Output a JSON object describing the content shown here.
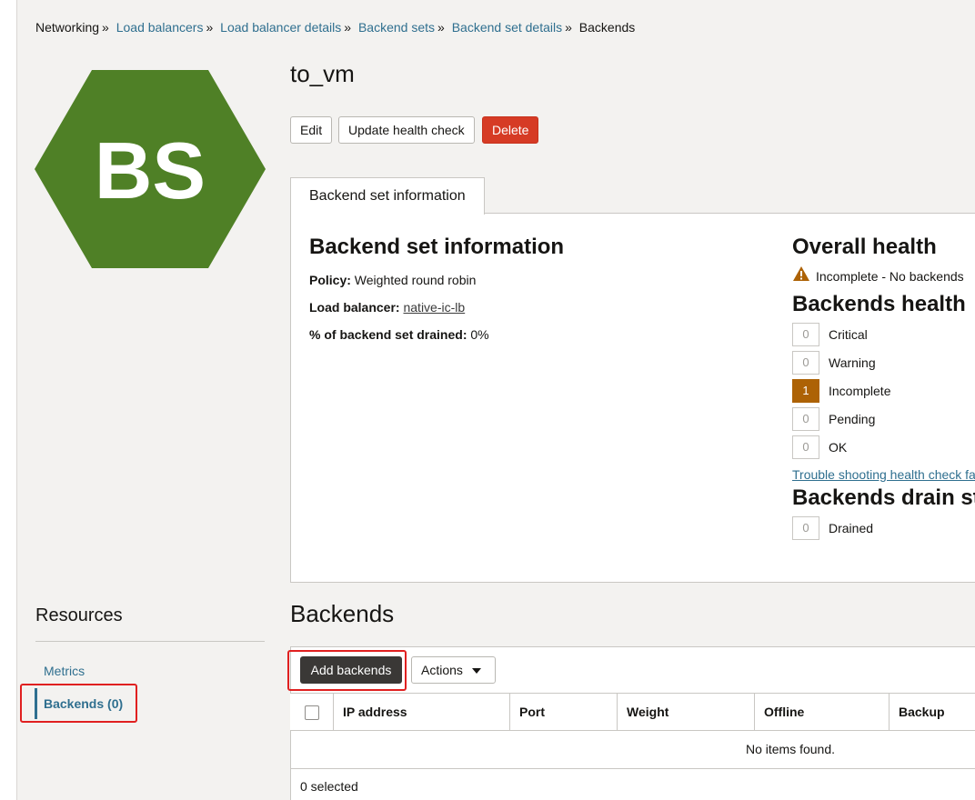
{
  "breadcrumb": {
    "root": "Networking",
    "links": [
      "Load balancers",
      "Load balancer details",
      "Backend sets",
      "Backend set details"
    ],
    "current": "Backends",
    "separator": "»"
  },
  "logo": {
    "text": "BS",
    "color": "#4f8026"
  },
  "page": {
    "title": "to_vm"
  },
  "toolbar": {
    "edit": "Edit",
    "update_health": "Update health check",
    "delete": "Delete"
  },
  "tab": {
    "label": "Backend set information"
  },
  "info": {
    "heading": "Backend set information",
    "policy_label": "Policy:",
    "policy_value": "Weighted round robin",
    "lb_label": "Load balancer:",
    "lb_value": "native-ic-lb",
    "drained_label": "% of backend set drained:",
    "drained_value": "0%"
  },
  "health": {
    "overall_heading": "Overall health",
    "overall_status": "Incomplete - No backends",
    "backends_heading": "Backends health",
    "rows": [
      {
        "count": "0",
        "label": "Critical"
      },
      {
        "count": "0",
        "label": "Warning"
      },
      {
        "count": "1",
        "label": "Incomplete"
      },
      {
        "count": "0",
        "label": "Pending"
      },
      {
        "count": "0",
        "label": "OK"
      }
    ],
    "trouble_link": "Trouble shooting health check fa",
    "drain_heading": "Backends drain st",
    "drain_row": {
      "count": "0",
      "label": "Drained"
    }
  },
  "resources": {
    "title": "Resources",
    "items": [
      {
        "label": "Metrics"
      },
      {
        "label": "Backends (0)"
      }
    ]
  },
  "backends": {
    "title": "Backends",
    "add_button": "Add backends",
    "actions_button": "Actions",
    "columns": [
      "IP address",
      "Port",
      "Weight",
      "Offline",
      "Backup"
    ],
    "empty_message": "No items found.",
    "selected": "0 selected"
  }
}
